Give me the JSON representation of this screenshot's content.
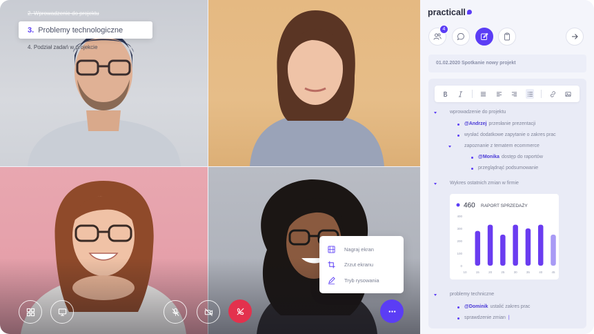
{
  "agenda": {
    "previous": "2. Wprowadzenie do projektu",
    "current_number": "3.",
    "current_label": "Problemy technologiczne",
    "next": "4. Podział zadań w projekcie"
  },
  "context_menu": [
    {
      "icon": "film-icon",
      "label": "Nagraj ekran"
    },
    {
      "icon": "crop-icon",
      "label": "Zrzut ekranu"
    },
    {
      "icon": "pen-icon",
      "label": "Tryb rysowania"
    }
  ],
  "brand": {
    "name": "practicall",
    "accent": "#5b3df5",
    "end_call_color": "#e3314d"
  },
  "participants_count": "4",
  "meeting_title": "01.02.2020 Spotkanie nowy projekt",
  "notes": {
    "item1": "wprowadzenie do projektu",
    "item1_a_mention": "@Andrzej",
    "item1_a_text": "przesłanie prezentacji",
    "item1_b": "wysłać dodatkowe zapytanie o zakres prac",
    "item1_c": "zapoznanie z tematem ecommerce",
    "item1_c1_mention": "@Monika",
    "item1_c1_text": "dostęp do raportów",
    "item1_c2": "przeglądnąć podsumowanie",
    "item2": "Wykres ostatnich zmian w firmie",
    "item3": "problemy techniczne",
    "item3_a_mention": "@Dominik",
    "item3_a_text": "ustalić zakres prac",
    "item3_b": "sprawdzenie zmian"
  },
  "chart_data": {
    "type": "bar",
    "title": "RAPORT SPRZEDAŻY",
    "headline_value": "460",
    "categories": [
      "10",
      "15",
      "20",
      "25",
      "30",
      "35",
      "40",
      "45"
    ],
    "values": [
      280,
      330,
      250,
      330,
      300,
      330,
      250,
      0
    ],
    "bars_x": [
      "15",
      "20",
      "25",
      "30",
      "35",
      "40",
      "45"
    ],
    "bar_values": [
      280,
      330,
      250,
      330,
      300,
      330,
      250
    ],
    "yticks": [
      "0",
      "100",
      "200",
      "300",
      "400"
    ],
    "ylim": [
      0,
      400
    ],
    "colors": [
      "#6a3cf0",
      "#6a3cf0",
      "#6a3cf0",
      "#6a3cf0",
      "#6a3cf0",
      "#6a3cf0",
      "#a89af5"
    ]
  }
}
